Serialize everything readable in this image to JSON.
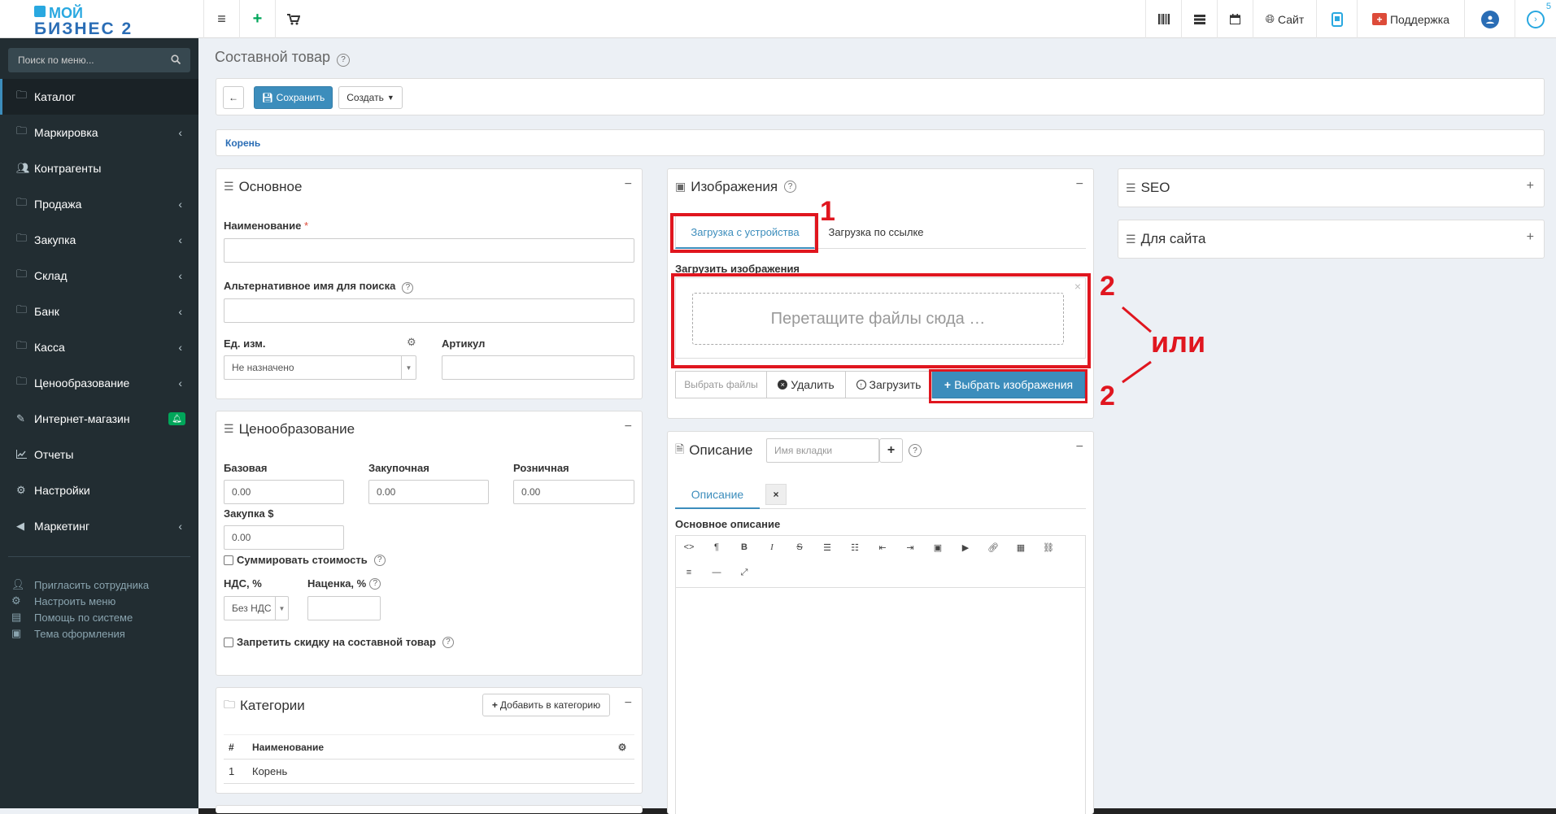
{
  "topbar": {
    "logo_line1": "МОЙ",
    "logo_line2": "БИЗНЕС 2",
    "site_label": "Сайт",
    "support_label": "Поддержка",
    "notification_count": "5"
  },
  "sidebar": {
    "search_placeholder": "Поиск по меню...",
    "items": [
      {
        "label": "Каталог",
        "icon": "folder-icon"
      },
      {
        "label": "Маркировка",
        "icon": "folder-icon"
      },
      {
        "label": "Контрагенты",
        "icon": "users-icon"
      },
      {
        "label": "Продажа",
        "icon": "folder-icon"
      },
      {
        "label": "Закупка",
        "icon": "folder-icon"
      },
      {
        "label": "Склад",
        "icon": "folder-icon"
      },
      {
        "label": "Банк",
        "icon": "folder-icon"
      },
      {
        "label": "Касса",
        "icon": "folder-icon"
      },
      {
        "label": "Ценообразование",
        "icon": "folder-icon"
      },
      {
        "label": "Интернет-магазин",
        "icon": "magic-icon"
      },
      {
        "label": "Отчеты",
        "icon": "chart-icon"
      },
      {
        "label": "Настройки",
        "icon": "gear-icon"
      },
      {
        "label": "Маркетинг",
        "icon": "bullhorn-icon"
      }
    ],
    "links": [
      "Пригласить сотрудника",
      "Настроить меню",
      "Помощь по системе",
      "Тема оформления"
    ]
  },
  "page": {
    "title": "Составной товар",
    "save_label": "Сохранить",
    "create_label": "Создать",
    "breadcrumb": "Корень"
  },
  "basic": {
    "title": "Основное",
    "name_label": "Наименование",
    "alt_name_label": "Альтернативное имя для поиска",
    "unit_label": "Ед. изм.",
    "unit_value": "Не назначено",
    "article_label": "Артикул"
  },
  "pricing": {
    "title": "Ценообразование",
    "base_label": "Базовая",
    "purchase_label": "Закупочная",
    "retail_label": "Розничная",
    "base_value": "0.00",
    "purchase_value": "0.00",
    "retail_value": "0.00",
    "purchase_usd_label": "Закупка $",
    "purchase_usd_value": "0.00",
    "sum_cost_label": "Суммировать стоимость",
    "vat_label": "НДС, %",
    "vat_value": "Без НДС",
    "markup_label": "Наценка, %",
    "no_discount_label": "Запретить скидку на составной товар"
  },
  "categories": {
    "title": "Категории",
    "add_label": "Добавить в категорию",
    "col_num": "#",
    "col_name": "Наименование",
    "rows": [
      {
        "num": "1",
        "name": "Корень"
      }
    ]
  },
  "images": {
    "title": "Изображения",
    "tab_device": "Загрузка с устройства",
    "tab_link": "Загрузка по ссылке",
    "upload_label": "Загрузить изображения",
    "drop_text": "Перетащите файлы сюда …",
    "choose_files": "Выбрать файлы",
    "delete_label": "Удалить",
    "upload_btn": "Загрузить",
    "choose_images": "Выбрать изображения"
  },
  "description": {
    "title": "Описание",
    "tab_name_placeholder": "Имя вкладки",
    "tab_label": "Описание",
    "main_label": "Основное описание"
  },
  "right": {
    "seo_title": "SEO",
    "site_title": "Для сайта"
  },
  "annotations": {
    "num1": "1",
    "num2a": "2",
    "num2b": "2",
    "or_text": "или"
  }
}
